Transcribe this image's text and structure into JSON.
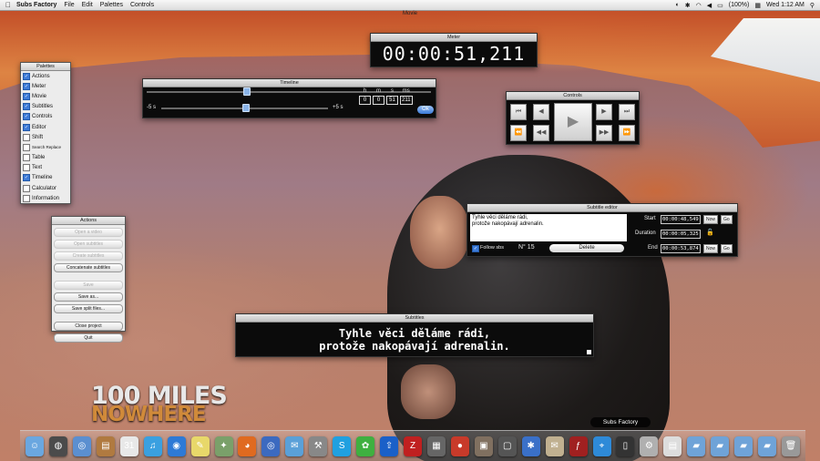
{
  "menubar": {
    "app_name": "Subs Factory",
    "menus": [
      "File",
      "Edit",
      "Palettes",
      "Controls"
    ],
    "battery": "(100%)",
    "clock": "Wed 1:12 AM"
  },
  "window_title": "Movie",
  "watermark": {
    "line1": "100 MILES",
    "line2": "NOWHERE"
  },
  "meter": {
    "title": "Meter",
    "time": "00:00:51,211"
  },
  "timeline": {
    "title": "Timeline",
    "position_fraction": 0.35,
    "offset_min_label": "-5 s",
    "offset_max_label": "+5 s",
    "offset_value_fraction": 0.5,
    "hms_headers": [
      "h",
      "m",
      "s",
      "ms"
    ],
    "hms_values": [
      "0",
      "0",
      "51",
      "211"
    ],
    "ok_label": "Ok"
  },
  "controls": {
    "title": "Controls"
  },
  "palettes": {
    "title": "Palettes",
    "items": [
      {
        "label": "Actions",
        "checked": true
      },
      {
        "label": "Meter",
        "checked": true
      },
      {
        "label": "Movie",
        "checked": true
      },
      {
        "label": "Subtitles",
        "checked": true
      },
      {
        "label": "Controls",
        "checked": true
      },
      {
        "label": "Editor",
        "checked": true
      },
      {
        "label": "Shift",
        "checked": false
      },
      {
        "label": "Search Replace",
        "checked": false
      },
      {
        "label": "Table",
        "checked": false
      },
      {
        "label": "Text",
        "checked": false
      },
      {
        "label": "Timeline",
        "checked": true
      },
      {
        "label": "Calculator",
        "checked": false
      },
      {
        "label": "Information",
        "checked": false
      }
    ]
  },
  "actions": {
    "title": "Actions",
    "buttons": [
      {
        "label": "Open a video",
        "enabled": false
      },
      {
        "label": "Open subtitles",
        "enabled": false
      },
      {
        "label": "Create subtitles",
        "enabled": false
      },
      {
        "label": "Concatenate subtitles",
        "enabled": true
      },
      {
        "label": "Save",
        "enabled": false
      },
      {
        "label": "Save as...",
        "enabled": true
      },
      {
        "label": "Save split files...",
        "enabled": true
      },
      {
        "label": "Close project",
        "enabled": true
      },
      {
        "label": "Quit",
        "enabled": true
      }
    ]
  },
  "editor": {
    "title": "Subtitle editor",
    "text_line1": "Tyhle věci děláme rádi,",
    "text_line2": "protože nakopávají adrenalin.",
    "follow_label": "Follow sbs",
    "number": "N° 15",
    "delete_label": "Delete",
    "start_label": "Start",
    "start_value": "00:00:48,549",
    "duration_label": "Duration",
    "duration_value": "00:00:05,325",
    "end_label": "End",
    "end_value": "00:00:53,874",
    "now_label": "Now",
    "go_label": "Go"
  },
  "subtitles": {
    "title": "Subtitles",
    "line1": "Tyhle věci děláme rádi,",
    "line2": "protože nakopávají adrenalin."
  },
  "dock": {
    "hover_label": "Subs Factory",
    "icons": [
      "finder-icon",
      "dashboard-icon",
      "preview-icon",
      "book-icon",
      "calendar-icon",
      "itunes-icon",
      "app-store-icon",
      "stickies-icon",
      "sherlock-icon",
      "firefox-icon",
      "globe-icon",
      "mail-icon",
      "tool-icon",
      "skype-icon",
      "icq-icon",
      "flickr-upload-icon",
      "filezilla-icon",
      "calculator-icon",
      "tomato-icon",
      "jar-icon",
      "screen-icon",
      "bluetooth-icon",
      "package-icon",
      "flash-icon",
      "safari-icon",
      "terminal-icon",
      "scripts-icon",
      "document-icon",
      "folder-icon",
      "folder-icon",
      "folder-icon",
      "folder-icon",
      "trash-icon"
    ]
  },
  "colors": {
    "accent": "#3d7bd8",
    "panel_dark": "#0b0b0b",
    "panel_light": "#ececec"
  }
}
